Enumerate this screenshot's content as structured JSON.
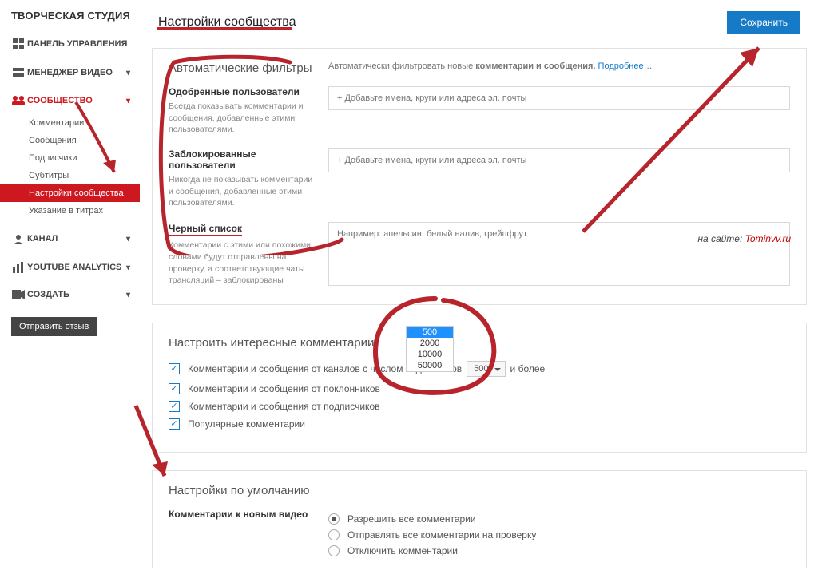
{
  "sidebar": {
    "studio": "ТВОРЧЕСКАЯ СТУДИЯ",
    "dashboard": "ПАНЕЛЬ УПРАВЛЕНИЯ",
    "videomgr": "МЕНЕДЖЕР ВИДЕО",
    "community": "СООБЩЕСТВО",
    "items": {
      "comments": "Комментарии",
      "messages": "Сообщения",
      "subscribers": "Подписчики",
      "captions": "Субтитры",
      "settings": "Настройки сообщества",
      "credits": "Указание в титрах"
    },
    "channel": "КАНАЛ",
    "analytics": "YOUTUBE ANALYTICS",
    "create": "СОЗДАТЬ",
    "feedback": "Отправить отзыв"
  },
  "header": {
    "title": "Настройки сообщества",
    "save": "Сохранить"
  },
  "filters": {
    "title": "Автоматические фильтры",
    "meta_text": "Автоматически фильтровать новые ",
    "meta_bold": "комментарии и сообщения.",
    "meta_link": "Подробнее…",
    "approved": {
      "title": "Одобренные пользователи",
      "desc": "Всегда показывать комментарии и сообщения, добавленные этими пользователями.",
      "ph": "+ Добавьте имена, круги или адреса эл. почты"
    },
    "blocked": {
      "title": "Заблокированные пользователи",
      "desc": "Никогда не показывать комментарии и сообщения, добавленные этими пользователями.",
      "ph": "+ Добавьте имена, круги или адреса эл. почты"
    },
    "blacklist": {
      "title": "Черный список",
      "desc": "Комментарии с этими или похожими словами будут отправлены на проверку, а соответствующие чаты трансляций – заблокированы",
      "ph": "Например: апельсин, белый налив, грейпфрут"
    }
  },
  "interesting": {
    "title": "Настроить интересные комментарии",
    "row1_pre": "Комментарии и сообщения от каналов с числом подписчиков",
    "row1_post": "и более",
    "row2": "Комментарии и сообщения от поклонников",
    "row3": "Комментарии и сообщения от подписчиков",
    "row4": "Популярные комментарии",
    "dd_value": "500",
    "options": [
      "500",
      "2000",
      "10000",
      "50000"
    ]
  },
  "defaults": {
    "title": "Настройки по умолчанию",
    "label": "Комментарии к новым видео",
    "r1": "Разрешить все комментарии",
    "r2": "Отправлять все комментарии на проверку",
    "r3": "Отключить комментарии"
  },
  "credit": {
    "text": "на сайте: ",
    "link": "Tominvv.ru"
  }
}
